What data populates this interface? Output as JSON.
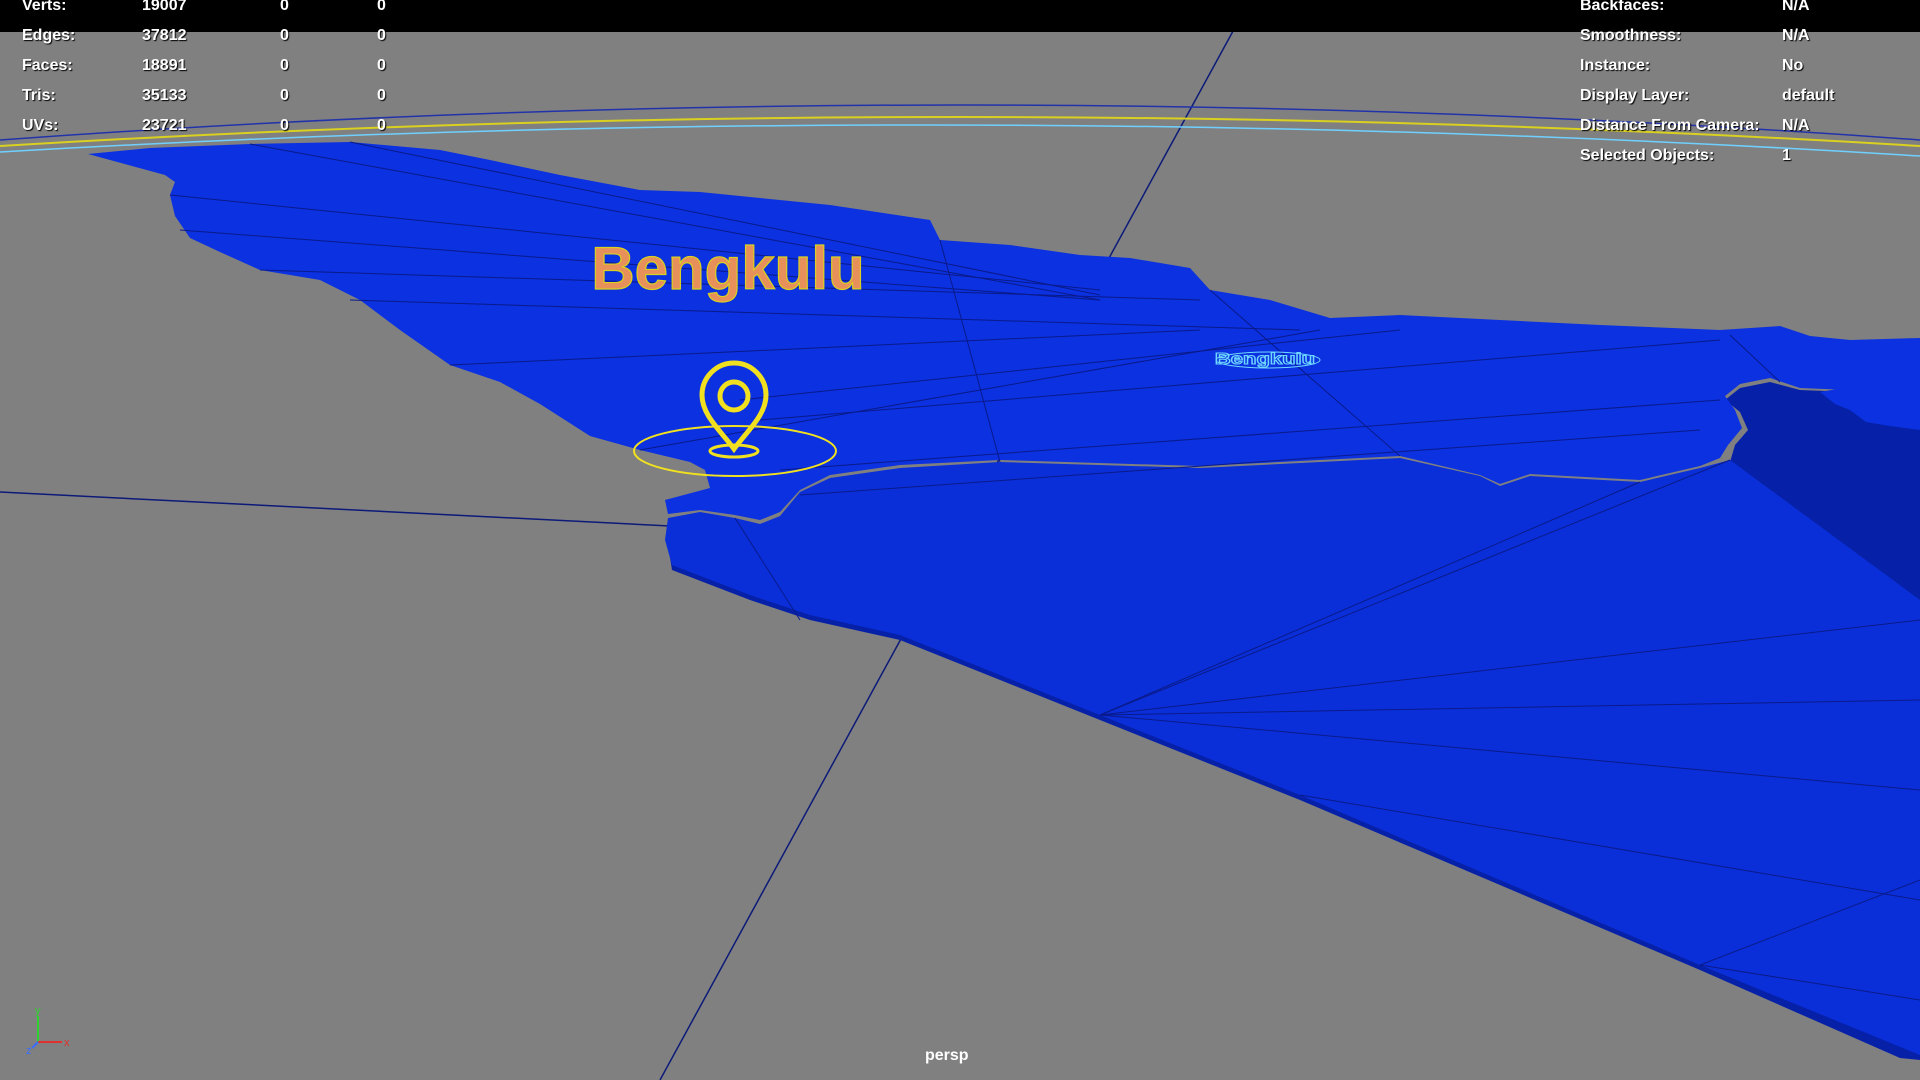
{
  "viewport": {
    "camera": "persp",
    "colors": {
      "background": "#808080",
      "mesh": "#0a2fd6",
      "mesh_edges": "#081a8c",
      "selection": "#f0e020",
      "label_3d": "#e8905a"
    }
  },
  "hud_left": {
    "rows": [
      {
        "label": "Verts:",
        "v1": "19007",
        "v2": "0",
        "v3": "0"
      },
      {
        "label": "Edges:",
        "v1": "37812",
        "v2": "0",
        "v3": "0"
      },
      {
        "label": "Faces:",
        "v1": "18891",
        "v2": "0",
        "v3": "0"
      },
      {
        "label": "Tris:",
        "v1": "35133",
        "v2": "0",
        "v3": "0"
      },
      {
        "label": "UVs:",
        "v1": "23721",
        "v2": "0",
        "v3": "0"
      }
    ]
  },
  "hud_right": {
    "rows": [
      {
        "label": "Backfaces:",
        "value": "N/A"
      },
      {
        "label": "Smoothness:",
        "value": "N/A"
      },
      {
        "label": "Instance:",
        "value": "No"
      },
      {
        "label": "Display Layer:",
        "value": "default"
      },
      {
        "label": "Distance From Camera:",
        "value": "N/A"
      },
      {
        "label": "Selected Objects:",
        "value": "1"
      }
    ]
  },
  "scene": {
    "map_label_text": "Bengkulu",
    "map_label_mirror_text": "Bengkulu",
    "marker_icon": "location-pin-icon"
  },
  "axis_gizmo": {
    "x": "x",
    "y": "y",
    "z": "z"
  }
}
